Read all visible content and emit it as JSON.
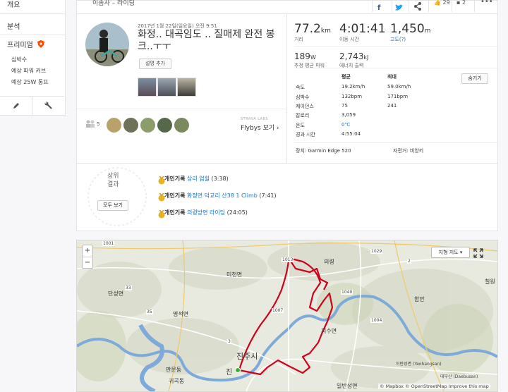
{
  "sidebar": {
    "overview": "개요",
    "analysis": "분석",
    "premium": "프리미엄",
    "sub_items": [
      "심박수",
      "예상 파워 커브",
      "예상 25W 통프"
    ]
  },
  "header": {
    "breadcrumb": "이솜사 – 라이딩",
    "like_count": "29",
    "comment_count": "2"
  },
  "activity": {
    "date": "2017년 1월 22일(일요일) 오전 9:51",
    "title": "화정.. 대곡임도 .. 질매제 완전 봉크..ㅜㅜ",
    "add_desc_label": "설명 추가"
  },
  "kudos": {
    "count": "5"
  },
  "flybys": {
    "label": "STRAVA LABS",
    "link": "Flybys 보기 ›"
  },
  "stats": {
    "distance": {
      "value": "77.2",
      "unit": "km",
      "label": "거리"
    },
    "moving_time": {
      "value": "4:01:41",
      "label": "이동 시간"
    },
    "elevation": {
      "value": "1,450",
      "unit": "m",
      "label": "고도(?)"
    },
    "power": {
      "value": "189",
      "unit": "W",
      "label": "추정 평균 파워"
    },
    "energy": {
      "value": "2,743",
      "unit": "kJ",
      "label": "에너지 출력"
    }
  },
  "table": {
    "col_avg": "평균",
    "col_max": "최대",
    "hide_label": "숨기기",
    "rows": [
      {
        "label": "속도",
        "avg": "19.2km/h",
        "max": "59.0km/h"
      },
      {
        "label": "심박수",
        "avg": "132bpm",
        "max": "171bpm"
      },
      {
        "label": "케이던스",
        "avg": "75",
        "max": "241"
      },
      {
        "label": "칼로리",
        "avg": "3,059",
        "max": ""
      },
      {
        "label": "온도",
        "avg": "0℃",
        "max": ""
      },
      {
        "label": "경과 시간",
        "avg": "4:55:04",
        "max": ""
      }
    ],
    "device": "장치: Garmin Edge 520",
    "bike": "자전거: 비앙키"
  },
  "achievements": {
    "badge_line1": "상위",
    "badge_line2": "결과",
    "view_all": "모두 보기",
    "items": [
      {
        "prefix": "개인기록",
        "segment": "상리 업힐",
        "time": "(3:38)"
      },
      {
        "prefix": "개인기록",
        "segment": "화정면 덕교리 산38 1 Climb",
        "time": "(7:41)"
      },
      {
        "prefix": "개인기록",
        "segment": "의령방면 라이딩",
        "time": "(24:05)"
      }
    ]
  },
  "map": {
    "zoom_in": "+",
    "zoom_out": "−",
    "map_type": "지형 지도 ▾",
    "attribution": "© Mapbox © OpenStreetMap Improve this map",
    "labels": [
      "단성면",
      "명석면",
      "미천면",
      "의령",
      "함안",
      "지수면",
      "진주시",
      "판문동",
      "귀곡동",
      "일반성면",
      "칠원",
      "이반성면 (Yeohangsan)",
      "대부산 (Daebusan)",
      "진"
    ],
    "road_numbers": [
      "1001",
      "1013",
      "1007",
      "1040",
      "1029",
      "1004",
      "35",
      "33",
      "2",
      "3"
    ],
    "colors": {
      "route": "#d0021b",
      "river": "#6a9cd8"
    }
  },
  "colors": {
    "accent": "#fc4c02",
    "link": "#1a72c5"
  }
}
